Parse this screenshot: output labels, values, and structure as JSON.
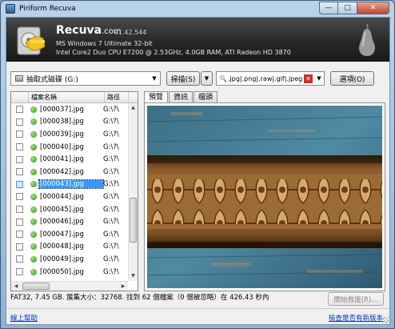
{
  "window": {
    "title": "Piriform Recuva",
    "minimize_glyph": "—",
    "maximize_glyph": "□",
    "close_glyph": "✕"
  },
  "header": {
    "app_name": "Recuva",
    "app_domain": ".com",
    "version": "v1.42.544",
    "os_line": "MS Windows 7 Ultimate 32-bit",
    "hw_line": "Intel Core2 Duo CPU E7200 @ 2.53GHz, 4.0GB RAM, ATI Radeon HD 3870"
  },
  "toolbar": {
    "drive_label": "抽取式磁碟 (G:)",
    "scan_label": "掃描(S)",
    "filter_text": ".jpg|.png|.raw|.gif|.jpeg",
    "options_label": "選項(O)"
  },
  "file_list": {
    "columns": [
      "檔案名稱",
      "路徑"
    ],
    "selected_index": 6,
    "rows": [
      {
        "name": "[000037].jpg",
        "path": "G:\\?\\"
      },
      {
        "name": "[000038].jpg",
        "path": "G:\\?\\"
      },
      {
        "name": "[000039].jpg",
        "path": "G:\\?\\"
      },
      {
        "name": "[000040].jpg",
        "path": "G:\\?\\"
      },
      {
        "name": "[000041].jpg",
        "path": "G:\\?\\"
      },
      {
        "name": "[000042].jpg",
        "path": "G:\\?\\"
      },
      {
        "name": "[000043].jpg",
        "path": "G:\\?\\"
      },
      {
        "name": "[000044].jpg",
        "path": "G:\\?\\"
      },
      {
        "name": "[000045].jpg",
        "path": "G:\\?\\"
      },
      {
        "name": "[000046].jpg",
        "path": "G:\\?\\"
      },
      {
        "name": "[000047].jpg",
        "path": "G:\\?\\"
      },
      {
        "name": "[000048].jpg",
        "path": "G:\\?\\"
      },
      {
        "name": "[000049].jpg",
        "path": "G:\\?\\"
      },
      {
        "name": "[000050].jpg",
        "path": "G:\\?\\"
      }
    ]
  },
  "tabs": {
    "preview": "預覽",
    "info": "資訊",
    "header": "檔頭"
  },
  "status": {
    "text": "FAT32, 7.45 GB. 簇集大小：32768. 找到 62 個檔案（0 個被忽略）在 426.43 秒內"
  },
  "recover_button": "開始救援(R)...",
  "footer": {
    "help_link": "線上幫助",
    "update_link": "檢查是否有新版本"
  },
  "colors": {
    "accent_selection": "#3399ff",
    "link": "#0033cc",
    "header_bg": "#262626"
  }
}
